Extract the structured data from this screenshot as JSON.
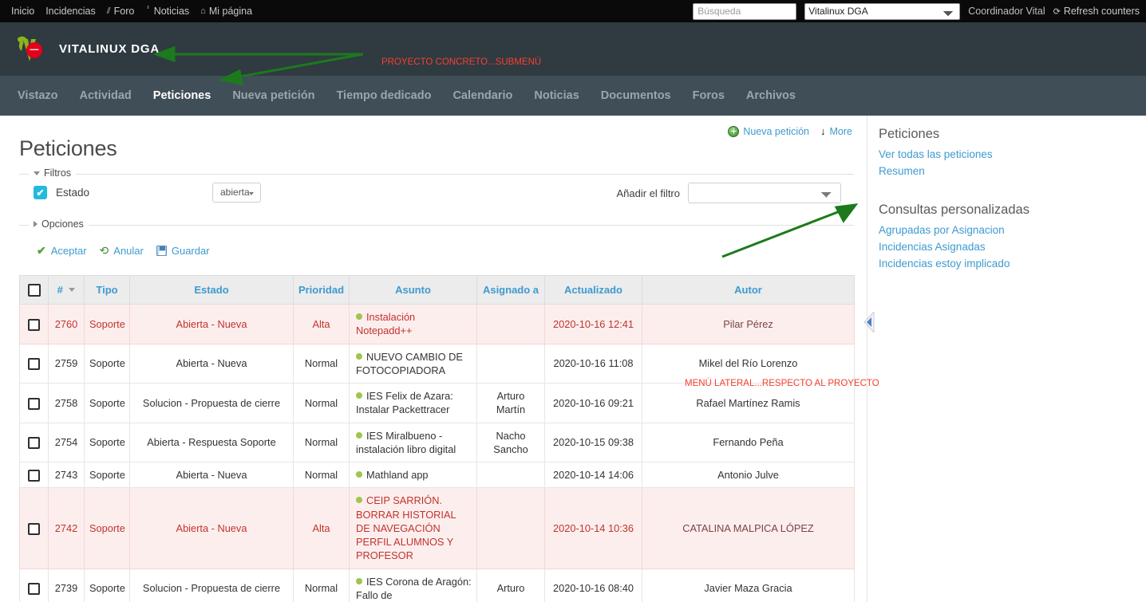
{
  "topbar": {
    "links": [
      {
        "label": "Inicio",
        "icon": null
      },
      {
        "label": "Incidencias",
        "icon": null
      },
      {
        "label": "Foro",
        "icon": "forum-icon"
      },
      {
        "label": "Noticias",
        "icon": "microphone-icon"
      },
      {
        "label": "Mi página",
        "icon": "home-icon"
      }
    ],
    "search_placeholder": "Búsqueda",
    "search_value": "",
    "project_selected": "Vitalinux DGA",
    "project_options": [
      "Vitalinux DGA"
    ],
    "user_label": "Coordinador Vital",
    "refresh_label": "Refresh counters",
    "refresh_icon": "refresh-icon"
  },
  "project_header": {
    "title": "VITALINUX DGA",
    "logo_icon": "vitalinux-logo-icon",
    "annotation": "PROYECTO CONCRETO...SUBMENÚ"
  },
  "tabs": [
    {
      "label": "Vistazo",
      "active": false
    },
    {
      "label": "Actividad",
      "active": false
    },
    {
      "label": "Peticiones",
      "active": true
    },
    {
      "label": "Nueva petición",
      "active": false
    },
    {
      "label": "Tiempo dedicado",
      "active": false
    },
    {
      "label": "Calendario",
      "active": false
    },
    {
      "label": "Noticias",
      "active": false
    },
    {
      "label": "Documentos",
      "active": false
    },
    {
      "label": "Foros",
      "active": false
    },
    {
      "label": "Archivos",
      "active": false
    }
  ],
  "content": {
    "page_title": "Peticiones",
    "new_issue_label": "Nueva petición",
    "more_label": "More",
    "annotation_side": "MENÚ LATERAL...RESPECTO AL PROYECTO"
  },
  "filters": {
    "legend": "Filtros",
    "estado_label": "Estado",
    "estado_checked": true,
    "estado_check_glyph": "✔",
    "operator_value": "abierta",
    "add_filter_label": "Añadir el filtro",
    "add_filter_value": "",
    "add_filter_options": [
      ""
    ]
  },
  "options": {
    "legend": "Opciones"
  },
  "actions": [
    {
      "label": "Aceptar",
      "icon": "check-icon"
    },
    {
      "label": "Anular",
      "icon": "reload-icon"
    },
    {
      "label": "Guardar",
      "icon": "save-icon"
    }
  ],
  "table": {
    "columns": [
      "",
      "#",
      "Tipo",
      "Estado",
      "Prioridad",
      "Asunto",
      "Asignado a",
      "Actualizado",
      "Autor"
    ],
    "sorted_column": "#",
    "rows": [
      {
        "id": "2760",
        "tipo": "Soporte",
        "estado": "Abierta - Nueva",
        "prioridad": "Alta",
        "asunto": "Instalación Notepadd++",
        "asignado": "",
        "actualizado": "2020-10-16 12:41",
        "autor": "Pilar Pérez",
        "highlighted": true
      },
      {
        "id": "2759",
        "tipo": "Soporte",
        "estado": "Abierta - Nueva",
        "prioridad": "Normal",
        "asunto": "NUEVO CAMBIO DE FOTOCOPIADORA",
        "asignado": "",
        "actualizado": "2020-10-16 11:08",
        "autor": "Mikel del Río Lorenzo",
        "highlighted": false
      },
      {
        "id": "2758",
        "tipo": "Soporte",
        "estado": "Solucion - Propuesta de cierre",
        "prioridad": "Normal",
        "asunto": "IES Felix de Azara: Instalar Packettracer",
        "asignado": "Arturo Martín",
        "actualizado": "2020-10-16 09:21",
        "autor": "Rafael Martínez Ramis",
        "highlighted": false
      },
      {
        "id": "2754",
        "tipo": "Soporte",
        "estado": "Abierta - Respuesta Soporte",
        "prioridad": "Normal",
        "asunto": "IES Miralbueno - instalación libro digital",
        "asignado": "Nacho Sancho",
        "actualizado": "2020-10-15 09:38",
        "autor": "Fernando Peña",
        "highlighted": false
      },
      {
        "id": "2743",
        "tipo": "Soporte",
        "estado": "Abierta - Nueva",
        "prioridad": "Normal",
        "asunto": "Mathland app",
        "asignado": "",
        "actualizado": "2020-10-14 14:06",
        "autor": "Antonio Julve",
        "highlighted": false
      },
      {
        "id": "2742",
        "tipo": "Soporte",
        "estado": "Abierta - Nueva",
        "prioridad": "Alta",
        "asunto": "CEIP SARRIÓN. BORRAR HISTORIAL DE NAVEGACIÓN PERFIL ALUMNOS Y PROFESOR",
        "asignado": "",
        "actualizado": "2020-10-14 10:36",
        "autor": "CATALINA MALPICA LÓPEZ",
        "highlighted": true
      },
      {
        "id": "2739",
        "tipo": "Soporte",
        "estado": "Solucion - Propuesta de cierre",
        "prioridad": "Normal",
        "asunto": "IES Corona de Aragón: Fallo de",
        "asignado": "Arturo",
        "actualizado": "2020-10-16 08:40",
        "autor": "Javier Maza Gracia",
        "highlighted": false
      }
    ]
  },
  "sidebar": {
    "section1_title": "Peticiones",
    "section1_links": [
      "Ver todas las peticiones",
      "Resumen"
    ],
    "section2_title": "Consultas personalizadas",
    "section2_links": [
      "Agrupadas por Asignacion",
      "Incidencias Asignadas",
      "Incidencias estoy implicado"
    ]
  },
  "colors": {
    "accent_link": "#3d9ad1",
    "highlight_row": "#fdeeee",
    "highlight_text": "#c0342c",
    "topbar_bg": "#0a0a0a",
    "projheader_bg": "#2f3a41",
    "tabnav_bg": "#404e58",
    "annotation": "#f4402f",
    "arrow": "#1c7a1c"
  }
}
